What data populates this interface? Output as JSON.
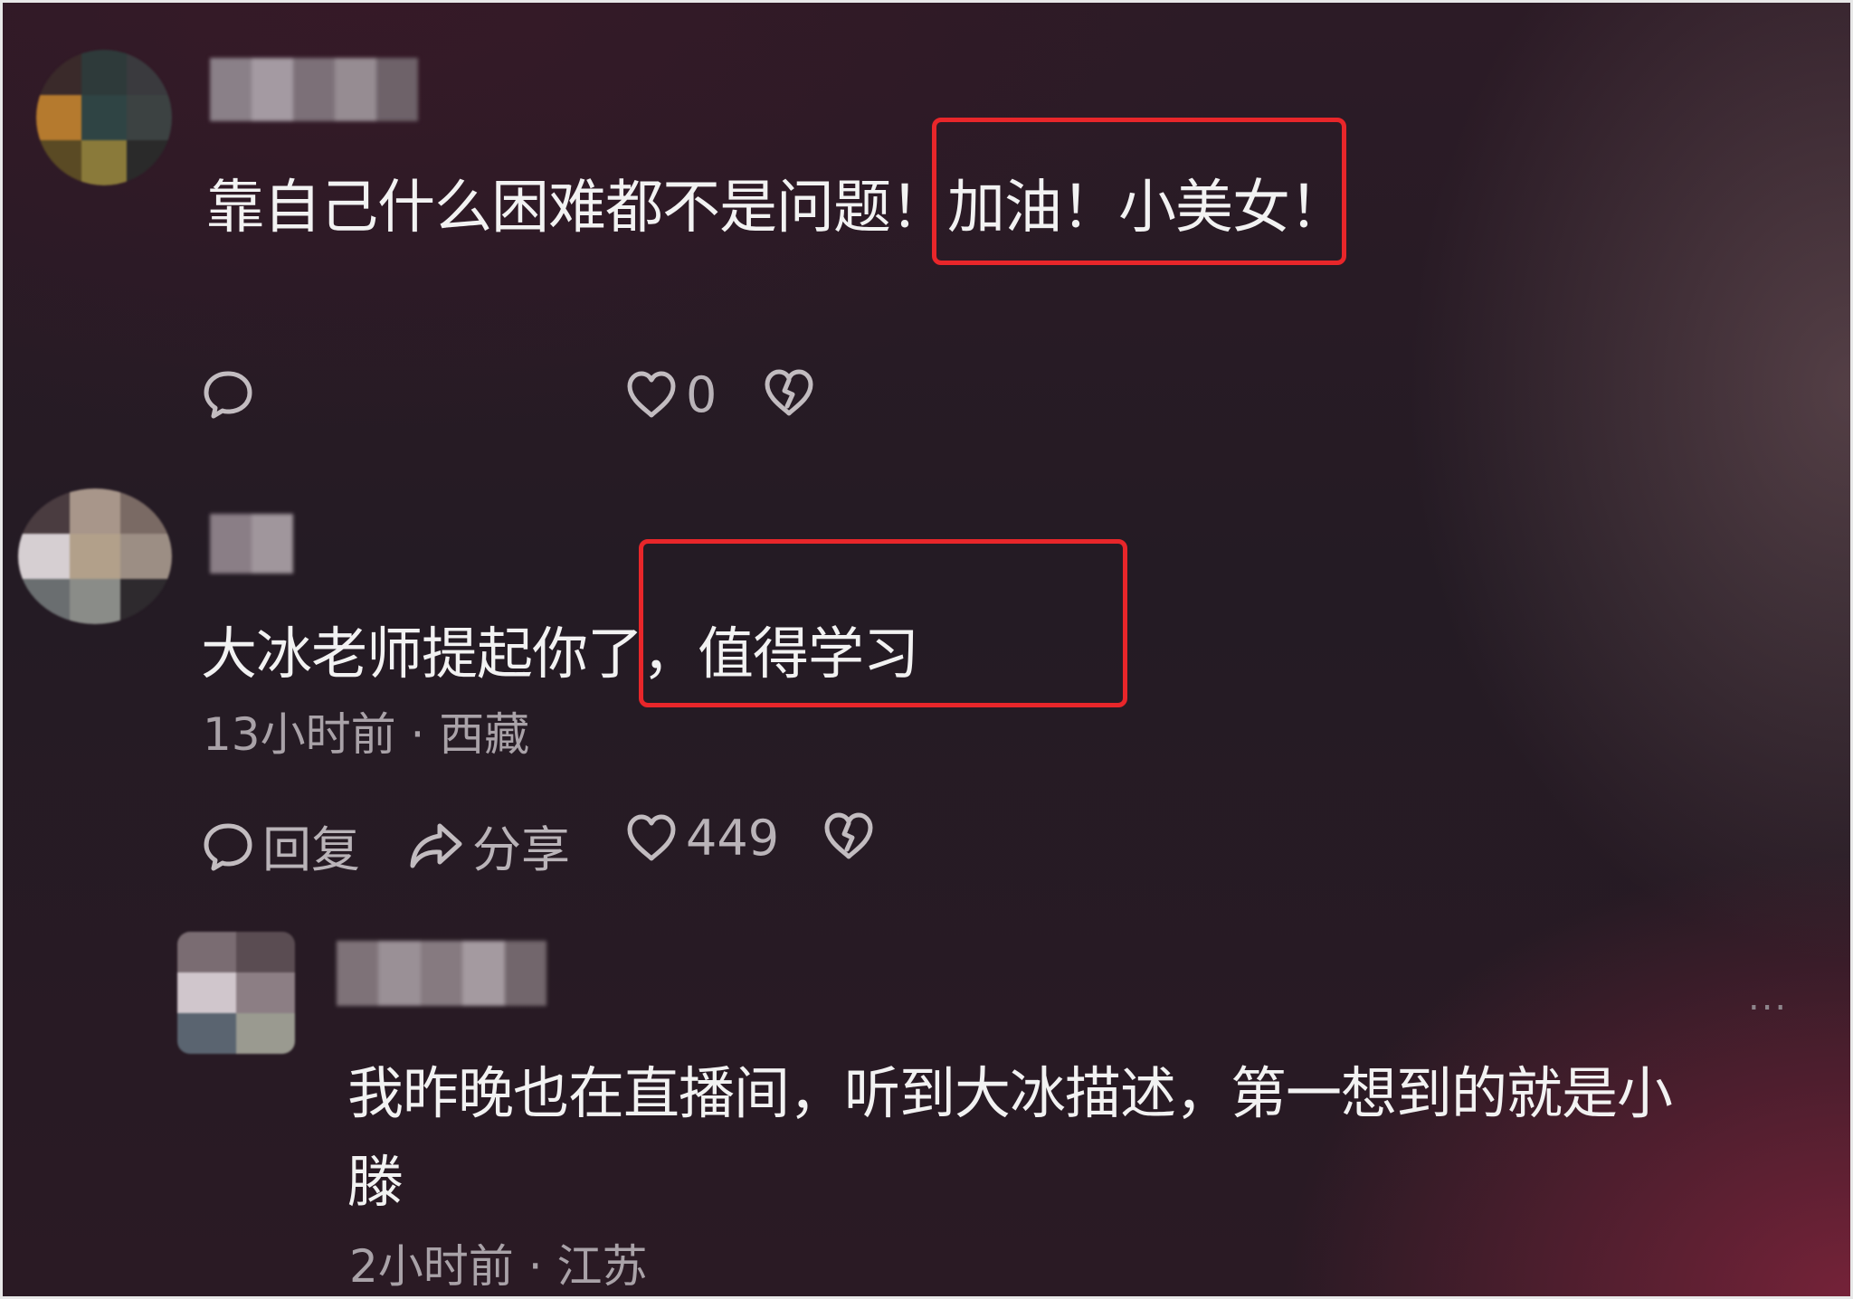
{
  "comments": [
    {
      "text": "靠自己什么困难都不是问题！加油！小美女！",
      "actions": {
        "like_count": "0"
      }
    },
    {
      "text": "大冰老师提起你了，值得学习",
      "time_location": "13小时前 · 西藏",
      "actions": {
        "reply_label": "回复",
        "share_label": "分享",
        "like_count": "449"
      }
    }
  ],
  "reply": {
    "text_line1": "我昨晚也在直播间，听到大冰描述，第一想到的就是小",
    "text_line2": "滕",
    "time_location": "2小时前 · 江苏",
    "more": "..."
  },
  "colors": {
    "highlight_box": "#e8262a",
    "text": "#f2f2f2",
    "meta": "#a9a2a8"
  },
  "icons": [
    "comment-icon",
    "heart-icon",
    "broken-heart-icon",
    "share-icon",
    "more-icon"
  ]
}
